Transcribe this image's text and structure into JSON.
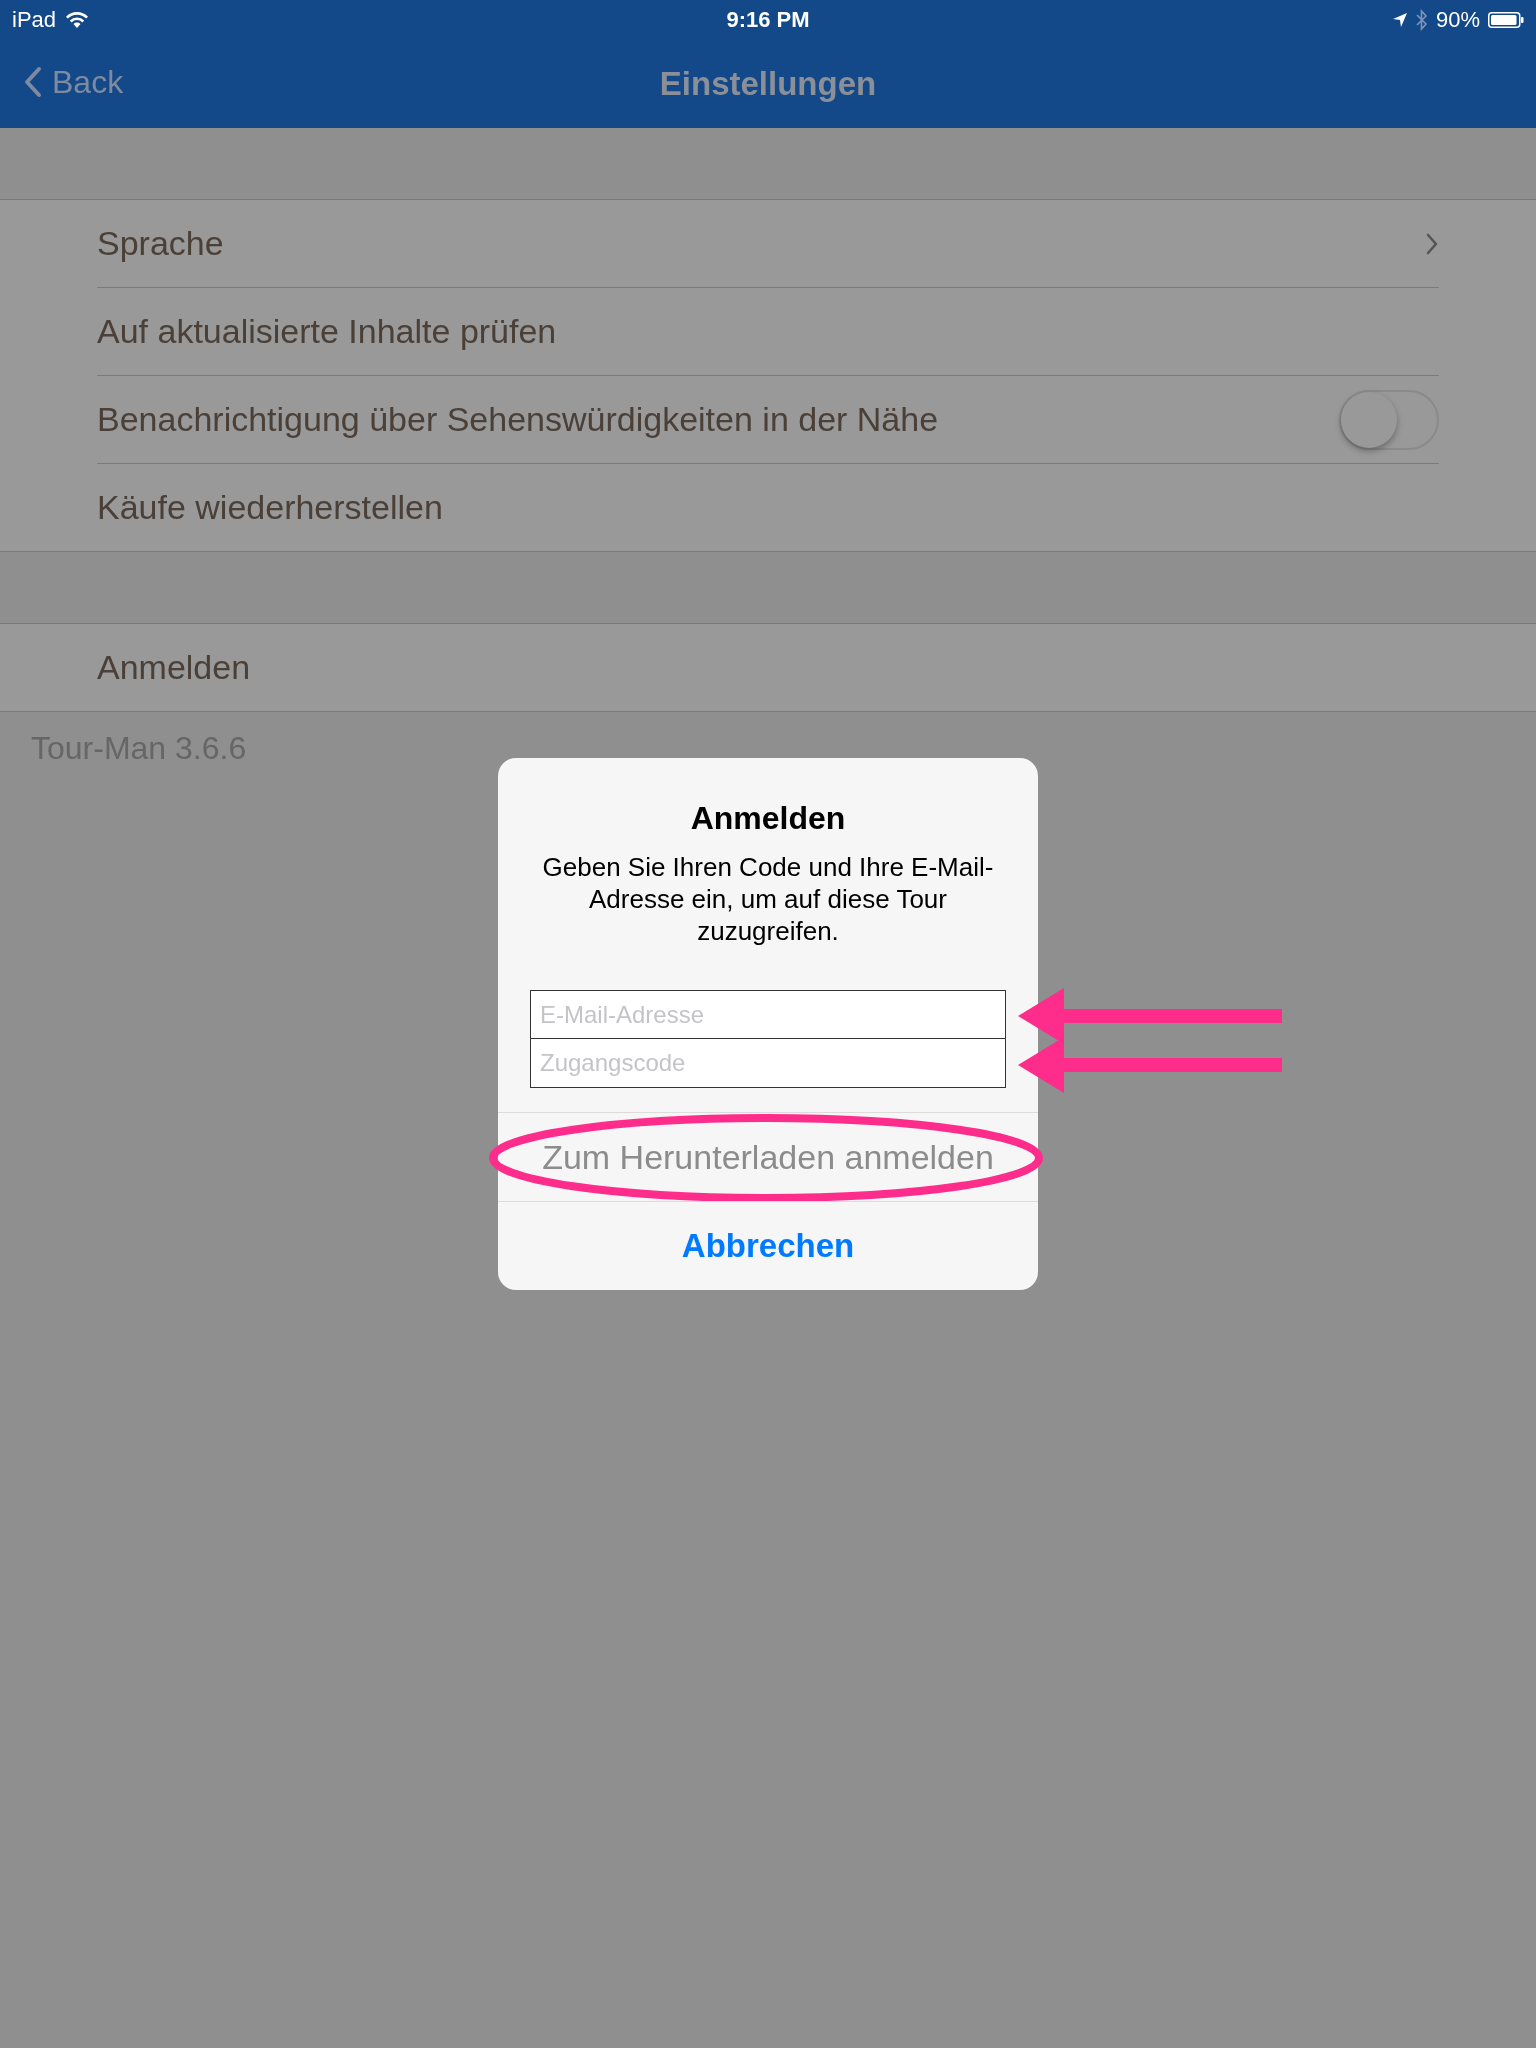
{
  "status_bar": {
    "device": "iPad",
    "time": "9:16 PM",
    "battery": "90%"
  },
  "nav": {
    "back": "Back",
    "title": "Einstellungen"
  },
  "sections": [
    {
      "rows": [
        {
          "kind": "disclosure",
          "label": "Sprache"
        },
        {
          "kind": "plain",
          "label": "Auf aktualisierte Inhalte prüfen"
        },
        {
          "kind": "toggle",
          "label": "Benachrichtigung über Sehenswürdigkeiten in der Nähe",
          "on": false
        },
        {
          "kind": "plain",
          "label": "Käufe wiederherstellen"
        }
      ]
    },
    {
      "rows": [
        {
          "kind": "plain",
          "label": "Anmelden"
        }
      ]
    }
  ],
  "version": "Tour-Man 3.6.6",
  "dialog": {
    "title": "Anmelden",
    "message": "Geben Sie Ihren Code und Ihre E-Mail-Adresse ein, um auf diese Tour zuzugreifen.",
    "fields": [
      {
        "kind": "arrow",
        "placeholder": "E-Mail-Adresse"
      },
      {
        "kind": "arrow",
        "placeholder": "Zugangscode"
      }
    ],
    "actions": [
      {
        "kind": "ellipse",
        "label": "Zum Herunterladen anmelden",
        "disabled": true
      },
      {
        "kind": "plain",
        "label": "Abbrechen",
        "disabled": false
      }
    ]
  }
}
